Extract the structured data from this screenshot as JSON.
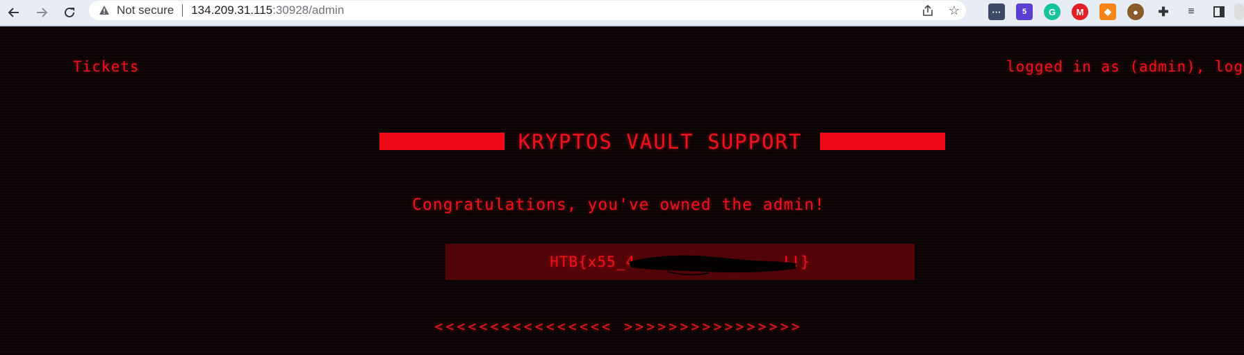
{
  "browser": {
    "back_icon": "arrow-left-icon",
    "forward_icon": "arrow-right-icon",
    "reload_icon": "reload-icon",
    "security_label": "Not secure",
    "url_host": "134.209.31.115",
    "url_rest": ":30928/admin",
    "extension_badge": "5"
  },
  "nav": {
    "tickets_label": "Tickets",
    "login_prefix": "logged in as (admin), ",
    "logout_label": "logout"
  },
  "main": {
    "title": "KRYPTOS VAULT SUPPORT",
    "congrats": "Congratulations, you've owned the admin!",
    "flag_visible": "HTB{x55_4",
    "flag_end": "...!!}",
    "arrows": "<<<<<<<<<<<<<<<<  >>>>>>>>>>>>>>>>"
  },
  "colors": {
    "accent": "#f0101c",
    "background": "#0b0304",
    "flag_box": "#520508"
  }
}
